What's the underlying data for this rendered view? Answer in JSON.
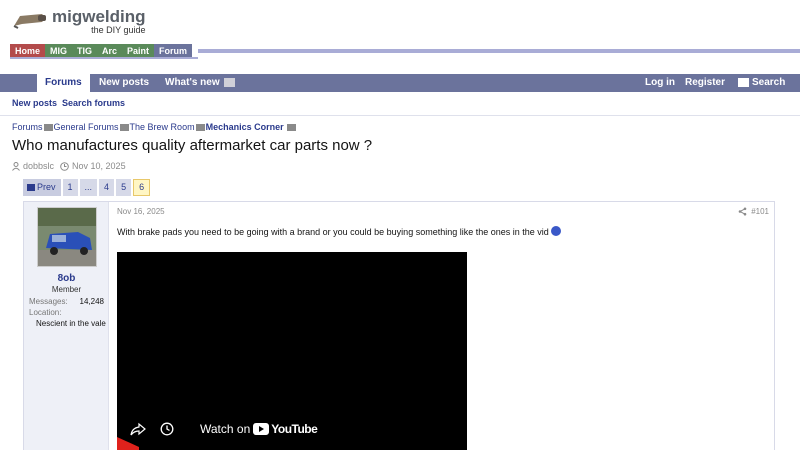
{
  "site": {
    "logo_title": "migwelding",
    "logo_sub": "the DIY guide",
    "tabs": [
      {
        "label": "Home",
        "color": "#b34b4b"
      },
      {
        "label": "MIG",
        "color": "#5a8a5a"
      },
      {
        "label": "TIG",
        "color": "#5a8a5a"
      },
      {
        "label": "Arc",
        "color": "#5a8a5a"
      },
      {
        "label": "Paint",
        "color": "#5a8a5a"
      },
      {
        "label": "Forum",
        "color": "#6b739c"
      }
    ]
  },
  "forum_nav": {
    "forums": "Forums",
    "new_posts": "New posts",
    "whats_new": "What's new",
    "login": "Log in",
    "register": "Register",
    "search": "Search"
  },
  "subnav": {
    "new_posts": "New posts",
    "search_forums": "Search forums"
  },
  "breadcrumb": {
    "items": [
      "Forums",
      "General Forums",
      "The Brew Room",
      "Mechanics Corner"
    ]
  },
  "thread": {
    "title": "Who manufactures quality aftermarket car parts now ?",
    "author": "dobbslc",
    "date": "Nov 10, 2025"
  },
  "pagination": {
    "prev": "Prev",
    "pages": [
      "1",
      "...",
      "4",
      "5",
      "6"
    ],
    "current": "6"
  },
  "post": {
    "user": {
      "name": "8ob",
      "title": "Member",
      "messages_label": "Messages:",
      "messages_value": "14,248",
      "location_label": "Location:",
      "location_value": "Nescient in the vale"
    },
    "date": "Nov 16, 2025",
    "number": "#101",
    "body": "With brake pads you need to be going with a brand or you could be buying something like the ones in the vid",
    "video": {
      "watch_on": "Watch on",
      "brand": "YouTube"
    }
  },
  "colors": {
    "accent": "#2a3a8c",
    "nav_bg": "#6b739c",
    "line": "#a9acd6"
  }
}
